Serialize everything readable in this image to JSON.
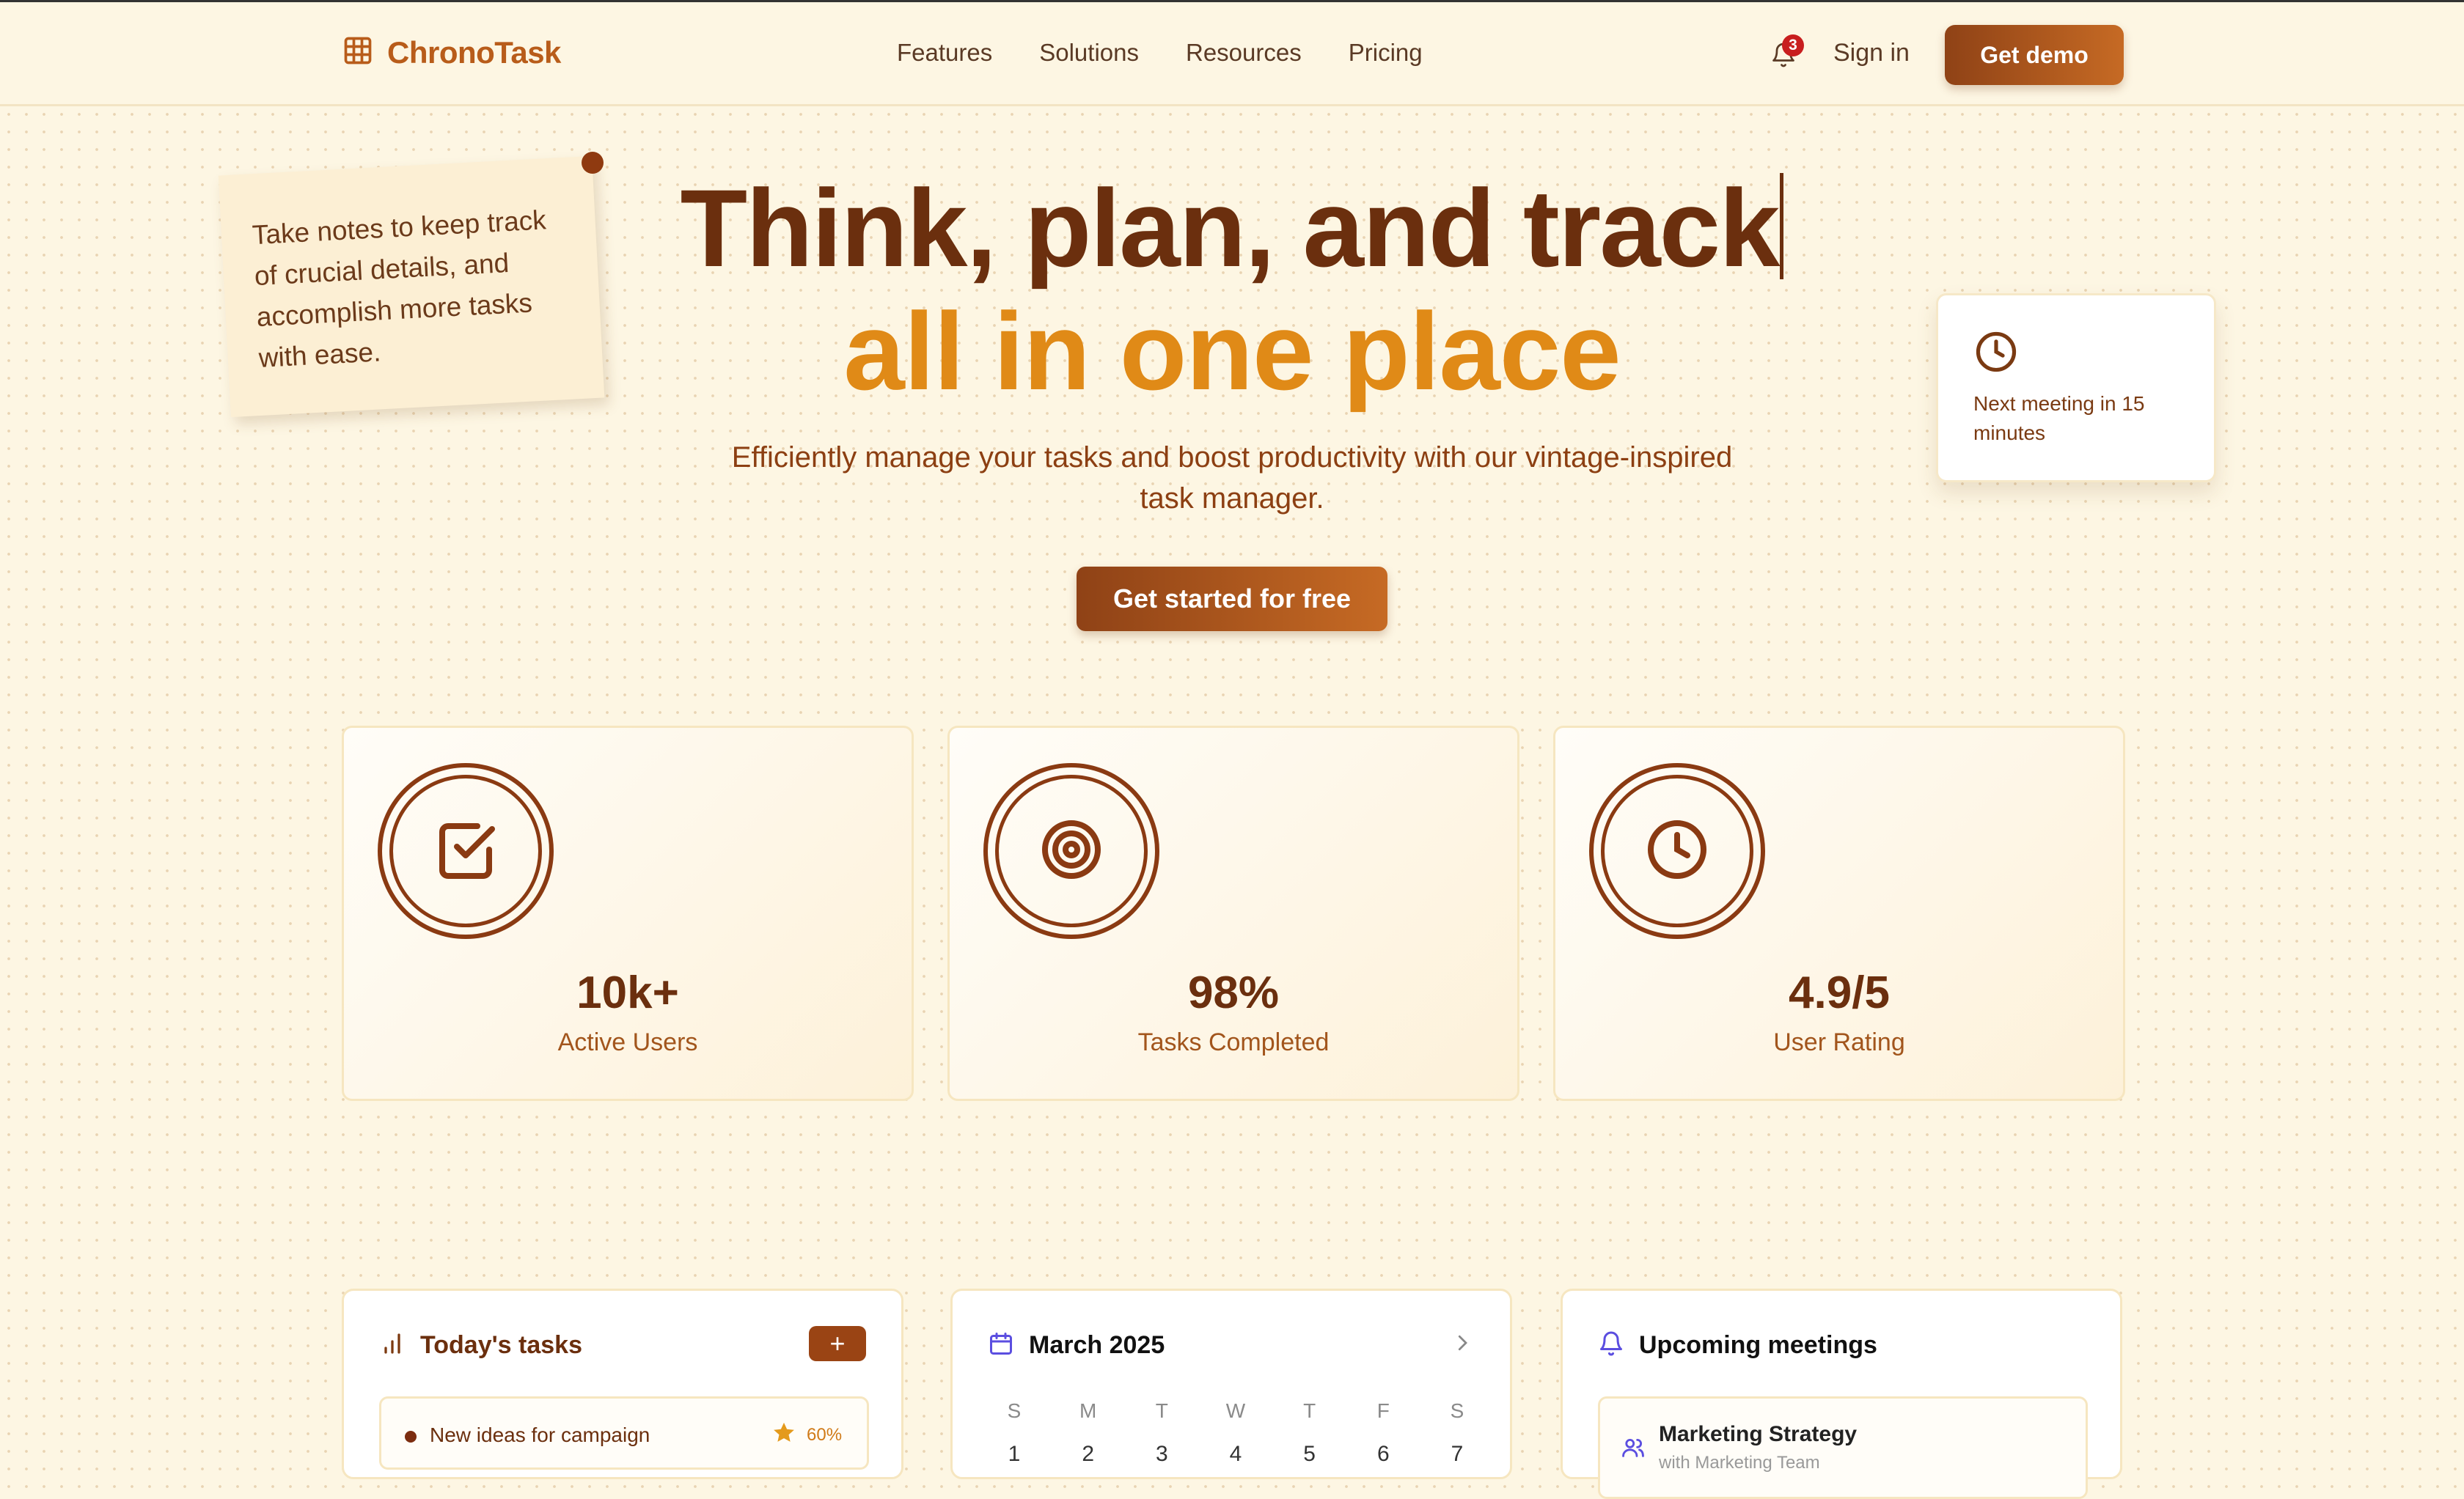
{
  "brand": {
    "name": "ChronoTask"
  },
  "nav": {
    "links": [
      "Features",
      "Solutions",
      "Resources",
      "Pricing"
    ],
    "notification_count": "3",
    "sign_in": "Sign in",
    "cta": "Get demo"
  },
  "note": {
    "text": "Take notes to keep track of crucial details, and accomplish more tasks with ease."
  },
  "hero": {
    "line1": "Think, plan, and track",
    "line2": "all in one place",
    "subtitle": "Efficiently manage your tasks and boost productivity with our vintage-inspired task manager.",
    "cta": "Get started for free"
  },
  "meeting_card": {
    "text": "Next meeting in 15 minutes"
  },
  "stats": [
    {
      "value": "10k+",
      "label": "Active Users",
      "icon": "check-square-icon"
    },
    {
      "value": "98%",
      "label": "Tasks Completed",
      "icon": "target-icon"
    },
    {
      "value": "4.9/5",
      "label": "User Rating",
      "icon": "clock-icon"
    }
  ],
  "tasks_panel": {
    "title": "Today's tasks",
    "add_label": "+",
    "items": [
      {
        "name": "New ideas for campaign",
        "progress": "60%"
      }
    ]
  },
  "calendar_panel": {
    "title": "March 2025",
    "weekdays": [
      "S",
      "M",
      "T",
      "W",
      "T",
      "F",
      "S"
    ],
    "dates": [
      "1",
      "2",
      "3",
      "4",
      "5",
      "6",
      "7"
    ]
  },
  "meetings_panel": {
    "title": "Upcoming meetings",
    "items": [
      {
        "title": "Marketing Strategy",
        "subtitle": "with Marketing Team"
      }
    ]
  },
  "colors": {
    "brand": "#b85c1a",
    "heading_dark": "#6b2f0e",
    "heading_accent": "#e08a17",
    "badge": "#c81e1e"
  }
}
